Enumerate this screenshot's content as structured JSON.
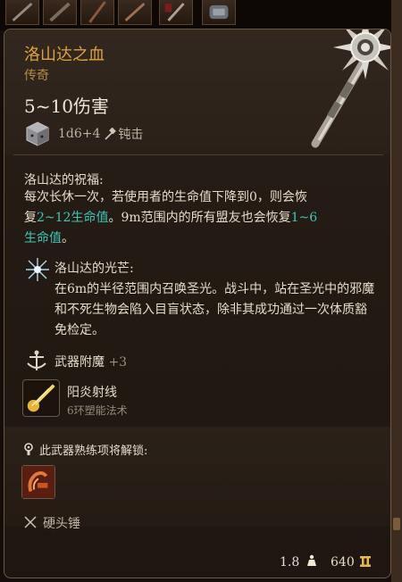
{
  "item": {
    "name": "洛山达之血",
    "rarity": "传奇",
    "damage": "5~10伤害",
    "dice": "1d6+4",
    "damage_type": "钝击"
  },
  "passive_blessing": {
    "title": "洛山达的祝福:",
    "line1_a": "每次",
    "line1_rest": "长休一次，若使用者的生命值下降到0，则会恢",
    "line2_a": "复",
    "heal_amount_1": "2~12生命值",
    "line2_b": "。9m范围内的所有盟友也会恢复",
    "heal_amount_2_a": "1~6",
    "heal_amount_2_b": "生命值",
    "line3_end": "。"
  },
  "radiance": {
    "title": "洛山达的光芒:",
    "description": "在6m的半径范围内召唤圣光。战斗中，站在圣光中的邪魔和不死生物会陷入目盲状态，除非其成功通过一次体质豁免检定。"
  },
  "enchantment": {
    "label": "武器附魔",
    "bonus": "+3"
  },
  "spell": {
    "name": "阳炎射线",
    "level": "6环塑能法术"
  },
  "proficiency": {
    "unlock_text": "此武器熟练项将解锁:",
    "weapon_type": "硬头锤"
  },
  "footer": {
    "weight": "1.8",
    "value": "640"
  },
  "colors": {
    "title_gold": "#e0a23e",
    "highlight_teal": "#3fc5b8",
    "panel_bg": "#221a13"
  }
}
